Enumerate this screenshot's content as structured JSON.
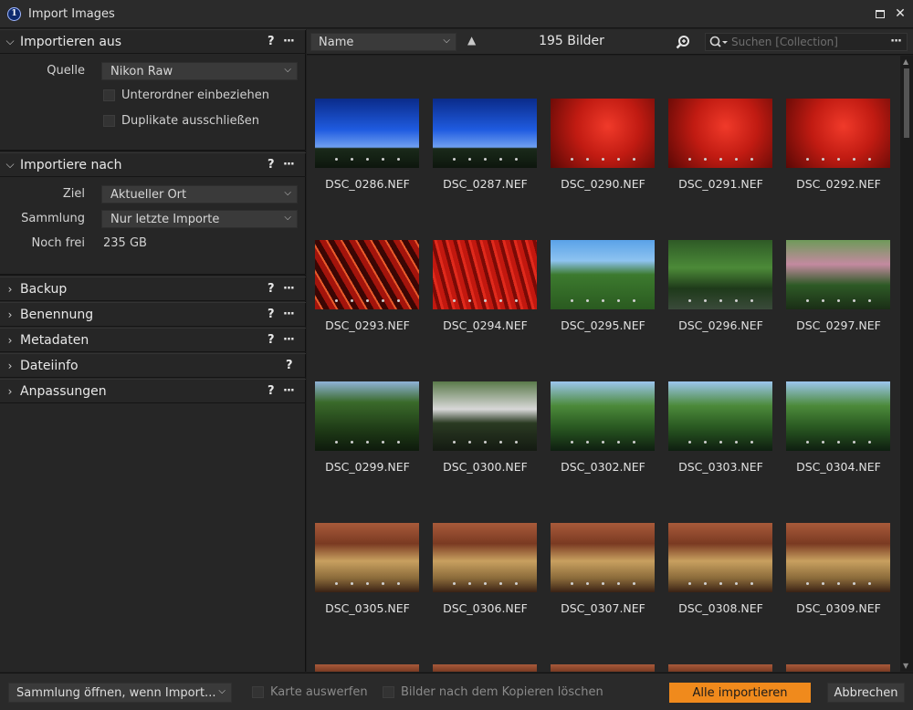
{
  "window": {
    "title": "Import Images"
  },
  "sections": {
    "source": {
      "title": "Importieren aus",
      "quelle_label": "Quelle",
      "quelle_value": "Nikon Raw",
      "subfolders_label": "Unterordner einbeziehen",
      "duplicates_label": "Duplikate ausschließen"
    },
    "destination": {
      "title": "Importiere nach",
      "ziel_label": "Ziel",
      "ziel_value": "Aktueller Ort",
      "sammlung_label": "Sammlung",
      "sammlung_value": "Nur letzte Importe",
      "free_label": "Noch frei",
      "free_value": "235 GB"
    },
    "collapsed": [
      {
        "title": "Backup",
        "has_more": true
      },
      {
        "title": "Benennung",
        "has_more": true
      },
      {
        "title": "Metadaten",
        "has_more": true
      },
      {
        "title": "Dateiinfo",
        "has_more": false
      },
      {
        "title": "Anpassungen",
        "has_more": true
      }
    ],
    "help_glyph": "?",
    "more_glyph": "···"
  },
  "toolbar": {
    "sort_value": "Name",
    "count": "195 Bilder",
    "search_placeholder": "Suchen [Collection]",
    "more_glyph": "···"
  },
  "thumbnails": [
    {
      "name": "DSC_0286.NEF",
      "kind": "sky-tower"
    },
    {
      "name": "DSC_0287.NEF",
      "kind": "sky-tower"
    },
    {
      "name": "DSC_0290.NEF",
      "kind": "umbrella"
    },
    {
      "name": "DSC_0291.NEF",
      "kind": "umbrella"
    },
    {
      "name": "DSC_0292.NEF",
      "kind": "umbrella"
    },
    {
      "name": "DSC_0293.NEF",
      "kind": "umbrella-dark"
    },
    {
      "name": "DSC_0294.NEF",
      "kind": "umbrella-close"
    },
    {
      "name": "DSC_0295.NEF",
      "kind": "trees-sky"
    },
    {
      "name": "DSC_0296.NEF",
      "kind": "garden"
    },
    {
      "name": "DSC_0297.NEF",
      "kind": "garden-bloom"
    },
    {
      "name": "DSC_0299.NEF",
      "kind": "garden-dark"
    },
    {
      "name": "DSC_0300.NEF",
      "kind": "people"
    },
    {
      "name": "DSC_0302.NEF",
      "kind": "pond"
    },
    {
      "name": "DSC_0303.NEF",
      "kind": "pond"
    },
    {
      "name": "DSC_0304.NEF",
      "kind": "pond"
    },
    {
      "name": "DSC_0305.NEF",
      "kind": "stage"
    },
    {
      "name": "DSC_0306.NEF",
      "kind": "stage"
    },
    {
      "name": "DSC_0307.NEF",
      "kind": "stage"
    },
    {
      "name": "DSC_0308.NEF",
      "kind": "stage"
    },
    {
      "name": "DSC_0309.NEF",
      "kind": "stage"
    }
  ],
  "bottom": {
    "collection_dd": "Sammlung öffnen, wenn Import...",
    "eject_label": "Karte auswerfen",
    "delete_label": "Bilder nach dem Kopieren löschen",
    "import_all": "Alle importieren",
    "cancel": "Abbrechen"
  },
  "colors": {
    "accent": "#f08a1c"
  }
}
